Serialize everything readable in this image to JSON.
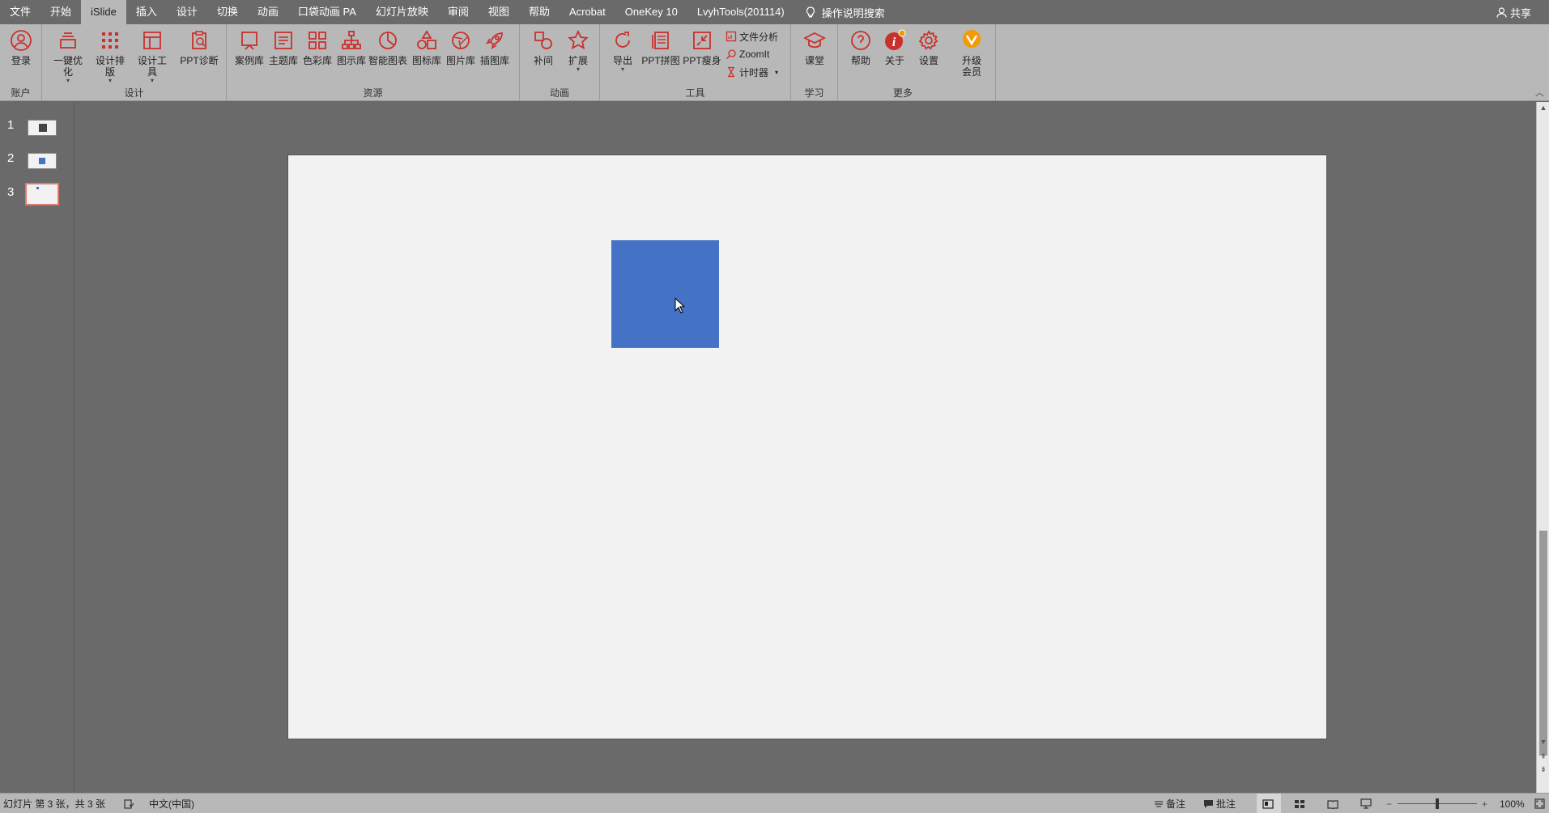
{
  "menu": {
    "tabs": [
      {
        "label": "文件",
        "active": false
      },
      {
        "label": "开始",
        "active": false
      },
      {
        "label": "iSlide",
        "active": true
      },
      {
        "label": "插入",
        "active": false
      },
      {
        "label": "设计",
        "active": false
      },
      {
        "label": "切换",
        "active": false
      },
      {
        "label": "动画",
        "active": false
      },
      {
        "label": "口袋动画 PA",
        "active": false
      },
      {
        "label": "幻灯片放映",
        "active": false
      },
      {
        "label": "审阅",
        "active": false
      },
      {
        "label": "视图",
        "active": false
      },
      {
        "label": "帮助",
        "active": false
      },
      {
        "label": "Acrobat",
        "active": false
      },
      {
        "label": "OneKey 10",
        "active": false
      },
      {
        "label": "LvyhTools(201114)",
        "active": false
      }
    ],
    "tell_me": "操作说明搜索",
    "share": "共享"
  },
  "ribbon": {
    "groups": {
      "account": "账户",
      "design": "设计",
      "resources": "资源",
      "animation": "动画",
      "tools": "工具",
      "learn": "学习",
      "more": "更多"
    },
    "buttons": {
      "login": "登录",
      "one_click_optimize": "一键优化",
      "design_layout": "设计排版",
      "design_tools": "设计工具",
      "ppt_diagnose": "PPT诊断",
      "case_library": "案例库",
      "theme_library": "主题库",
      "color_library": "色彩库",
      "diagram_library": "图示库",
      "smart_chart": "智能图表",
      "icon_library": "图标库",
      "image_library": "图片库",
      "illustration_library": "插图库",
      "tween": "补间",
      "extend": "扩展",
      "export": "导出",
      "ppt_collage": "PPT拼图",
      "ppt_slim": "PPT瘦身",
      "file_analysis": "文件分析",
      "zoomit": "ZoomIt",
      "timer": "计时器",
      "classroom": "课堂",
      "help": "帮助",
      "about": "关于",
      "settings": "设置",
      "upgrade_l1": "升级",
      "upgrade_l2": "会员"
    }
  },
  "slides": {
    "items": [
      {
        "number": "1",
        "selected": false
      },
      {
        "number": "2",
        "selected": false
      },
      {
        "number": "3",
        "selected": true
      }
    ]
  },
  "canvas": {
    "shape_color": "#4472c4"
  },
  "status": {
    "slide_info": "幻灯片 第 3 张，共 3 张",
    "language": "中文(中国)",
    "notes": "备注",
    "comments": "批注",
    "zoom": "100%",
    "zoom_minus": "−",
    "zoom_plus": "+"
  },
  "colors": {
    "accent_red": "#c9302c",
    "ribbon_bg": "#b8b8b8",
    "app_bg": "#6a6a6a",
    "upgrade_orange": "#f29a00"
  }
}
